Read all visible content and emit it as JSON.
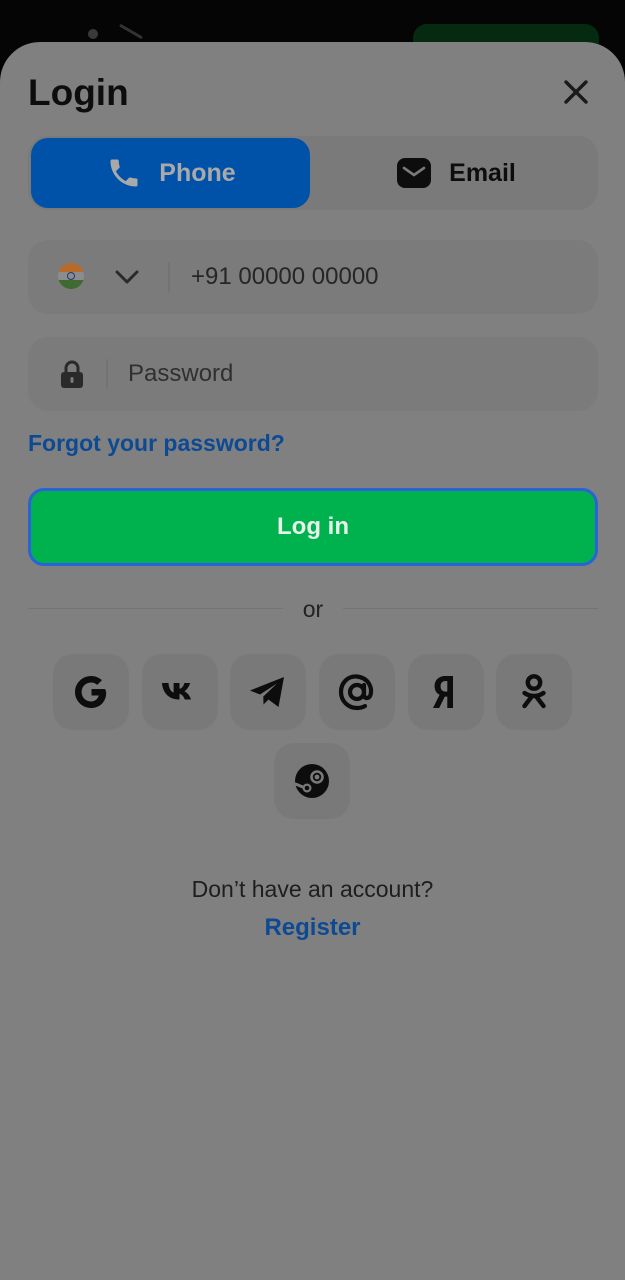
{
  "header": {
    "title": "Login"
  },
  "tabs": [
    {
      "label": "Phone",
      "icon": "phone-icon",
      "active": true
    },
    {
      "label": "Email",
      "icon": "envelope-icon",
      "active": false
    }
  ],
  "phone": {
    "country_flag": "india-flag-icon",
    "placeholder": "+91 00000 00000"
  },
  "password": {
    "placeholder": "Password"
  },
  "links": {
    "forgot": "Forgot your password?"
  },
  "actions": {
    "login_label": "Log in"
  },
  "separator": {
    "or_label": "or"
  },
  "social": [
    "google-icon",
    "vk-icon",
    "telegram-icon",
    "mail-ru-icon",
    "yandex-icon",
    "odnoklassniki-icon",
    "steam-icon"
  ],
  "footer": {
    "no_account": "Don’t have an account?",
    "register_label": "Register"
  },
  "colors": {
    "accent_blue": "#0052a8",
    "login_green": "#00b24d",
    "link_blue": "#0e4a94",
    "overlay": "#808080"
  }
}
